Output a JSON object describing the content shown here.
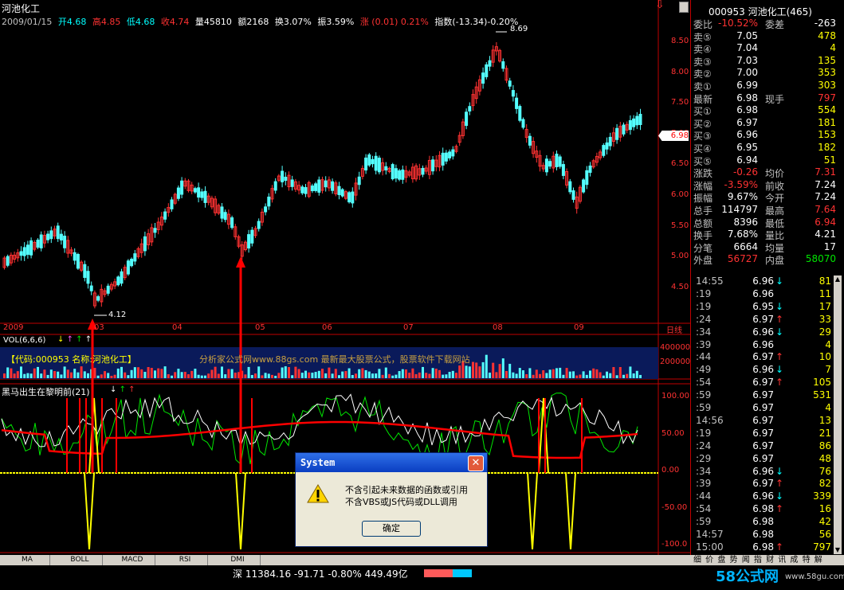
{
  "window": {
    "stock_name": "河池化工"
  },
  "info_bar": {
    "date": "2009/01/15",
    "open": "开4.68",
    "high": "高4.85",
    "low": "低4.68",
    "close": "收4.74",
    "volume": "量45810",
    "amount": "额2168",
    "turnover": "换3.07%",
    "amplitude": "振3.59%",
    "change": "涨 (0.01) 0.21%",
    "index": "指数(-13.34)-0.20%"
  },
  "price_axis": [
    "8.50",
    "8.00",
    "7.50",
    "7.00",
    "6.50",
    "6.00",
    "5.50",
    "5.00",
    "4.50"
  ],
  "annotations": {
    "high_label": "8.69",
    "low_label": "4.12",
    "current_price": "6.98"
  },
  "date_axis": [
    "2009",
    "03",
    "04",
    "05",
    "06",
    "07",
    "08",
    "09",
    "日线"
  ],
  "vol_panel": {
    "label": "VOL(6,6,6)",
    "axis": [
      "400000",
      "200000"
    ],
    "banner": "【代码:000953 名称:河池化工】",
    "ad": "分析家公式网www.88gs.com 最新最大股票公式，股票软件下载网站"
  },
  "indicator_panel": {
    "label": "黑马出生在黎明前(21)",
    "axis": [
      "100.00",
      "50.00",
      "0.00",
      "-50.00",
      "-100.0"
    ]
  },
  "quote_panel": {
    "header": "000953 河池化工(465)",
    "weibi": {
      "label": "委比",
      "value": "-10.52%",
      "label2": "委差",
      "value2": "-263"
    },
    "asks": [
      {
        "label": "卖⑤",
        "price": "7.05",
        "vol": "478"
      },
      {
        "label": "卖④",
        "price": "7.04",
        "vol": "4"
      },
      {
        "label": "卖③",
        "price": "7.03",
        "vol": "135"
      },
      {
        "label": "卖②",
        "price": "7.00",
        "vol": "353"
      },
      {
        "label": "卖①",
        "price": "6.99",
        "vol": "303"
      }
    ],
    "latest": {
      "label": "最新",
      "value": "6.98",
      "label2": "现手",
      "value2": "797"
    },
    "bids": [
      {
        "label": "买①",
        "price": "6.98",
        "vol": "554"
      },
      {
        "label": "买②",
        "price": "6.97",
        "vol": "181"
      },
      {
        "label": "买③",
        "price": "6.96",
        "vol": "153"
      },
      {
        "label": "买④",
        "price": "6.95",
        "vol": "182"
      },
      {
        "label": "买⑤",
        "price": "6.94",
        "vol": "51"
      }
    ],
    "stats": [
      {
        "l": "涨跌",
        "v": "-0.26",
        "l2": "均价",
        "v2": "7.31"
      },
      {
        "l": "涨幅",
        "v": "-3.59%",
        "l2": "前收",
        "v2": "7.24"
      },
      {
        "l": "振幅",
        "v": "9.67%",
        "l2": "今开",
        "v2": "7.24"
      },
      {
        "l": "总手",
        "v": "114797",
        "l2": "最高",
        "v2": "7.64"
      },
      {
        "l": "总额",
        "v": "8396",
        "l2": "最低",
        "v2": "6.94"
      },
      {
        "l": "换手",
        "v": "7.68%",
        "l2": "量比",
        "v2": "4.21"
      },
      {
        "l": "分笔",
        "v": "6664",
        "l2": "均量",
        "v2": "17"
      }
    ],
    "outer": {
      "label": "外盘",
      "value": "56727",
      "label2": "内盘",
      "value2": "58070"
    }
  },
  "ticks": [
    {
      "t": "14:55",
      "p": "6.96",
      "a": "↓",
      "v": "81"
    },
    {
      "t": ":19",
      "p": "6.96",
      "a": "",
      "v": "11"
    },
    {
      "t": ":19",
      "p": "6.95",
      "a": "↓",
      "v": "17"
    },
    {
      "t": ":24",
      "p": "6.97",
      "a": "↑",
      "v": "33"
    },
    {
      "t": ":34",
      "p": "6.96",
      "a": "↓",
      "v": "29"
    },
    {
      "t": ":39",
      "p": "6.96",
      "a": "",
      "v": "4"
    },
    {
      "t": ":44",
      "p": "6.97",
      "a": "↑",
      "v": "10"
    },
    {
      "t": ":49",
      "p": "6.96",
      "a": "↓",
      "v": "7"
    },
    {
      "t": ":54",
      "p": "6.97",
      "a": "↑",
      "v": "105"
    },
    {
      "t": ":59",
      "p": "6.97",
      "a": "",
      "v": "531"
    },
    {
      "t": ":59",
      "p": "6.97",
      "a": "",
      "v": "4"
    },
    {
      "t": "14:56",
      "p": "6.97",
      "a": "",
      "v": "13"
    },
    {
      "t": ":19",
      "p": "6.97",
      "a": "",
      "v": "21"
    },
    {
      "t": ":24",
      "p": "6.97",
      "a": "",
      "v": "86"
    },
    {
      "t": ":29",
      "p": "6.97",
      "a": "",
      "v": "48"
    },
    {
      "t": ":34",
      "p": "6.96",
      "a": "↓",
      "v": "76"
    },
    {
      "t": ":39",
      "p": "6.97",
      "a": "↑",
      "v": "82"
    },
    {
      "t": ":44",
      "p": "6.96",
      "a": "↓",
      "v": "339"
    },
    {
      "t": ":54",
      "p": "6.98",
      "a": "↑",
      "v": "16"
    },
    {
      "t": ":59",
      "p": "6.98",
      "a": "",
      "v": "42"
    },
    {
      "t": "14:57",
      "p": "6.98",
      "a": "",
      "v": "56"
    },
    {
      "t": "15:00",
      "p": "6.98",
      "a": "↑",
      "v": "797"
    }
  ],
  "bottom_tabs": [
    "MA",
    "BOLL",
    "MACD",
    "RSI",
    "DMI"
  ],
  "right_tabs": "细 价 盘 势 闻 指 财 讯 成 特 解",
  "status_bar": {
    "index": "深 11384.16 -91.71 -0.80% 449.49亿",
    "brand": "58公式网",
    "url": "www.58gu.com"
  },
  "dialog": {
    "title": "System",
    "line1": "不含引起未来数据的函数或引用",
    "line2": "不含VBS或JS代码或DLL调用",
    "ok": "确定"
  },
  "colors": {
    "up": "#ff3232",
    "down": "#54ffff",
    "axis": "#c00000",
    "ma_white": "#ffffff",
    "ma_red": "#ff0000",
    "ma_green": "#00e600",
    "signal_yellow": "#ffff00"
  }
}
